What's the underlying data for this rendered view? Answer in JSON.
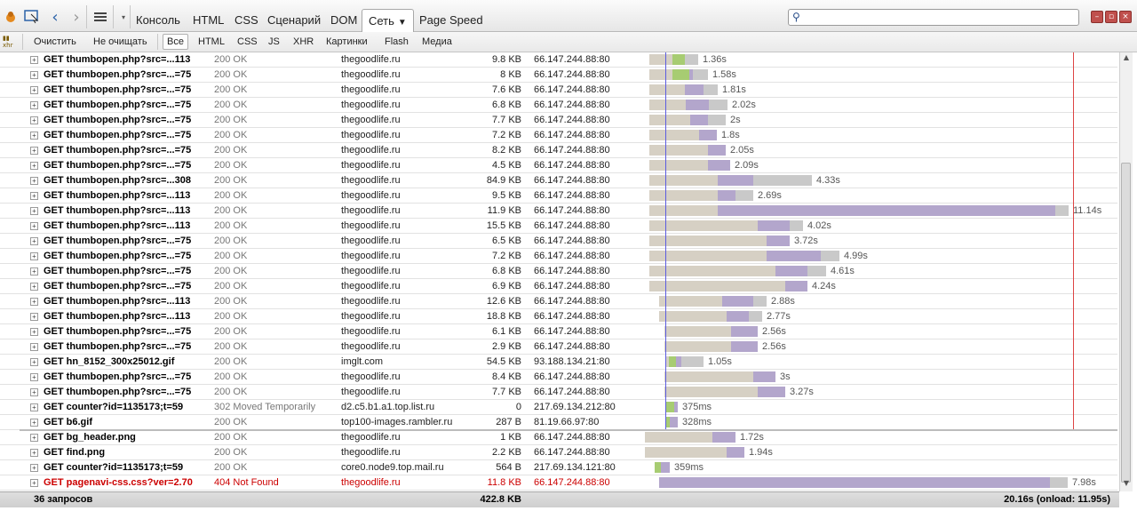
{
  "toolbar": {
    "tabs": [
      "Консоль",
      "HTML",
      "CSS",
      "Сценарий",
      "DOM",
      "Сеть",
      "Page Speed"
    ],
    "active_tab": "Сеть",
    "search": {
      "value": "",
      "placeholder": ""
    }
  },
  "filters": [
    "Очистить",
    "Не очищать",
    "Все",
    "HTML",
    "CSS",
    "JS",
    "XHR",
    "Картинки",
    "Flash",
    "Медиа"
  ],
  "selected_filter": "Все",
  "requests": [
    {
      "url": "GET thumbopen.php?src=...113",
      "status": "200 OK",
      "domain": "thegoodlife.ru",
      "size": "9.8 KB",
      "ip": "66.147.244.88:80",
      "time": "1.36s",
      "start": 731,
      "wait": 26,
      "conn": 14,
      "recv": 0,
      "post": 15
    },
    {
      "url": "GET thumbopen.php?src=...=75",
      "status": "200 OK",
      "domain": "thegoodlife.ru",
      "size": "8 KB",
      "ip": "66.147.244.88:80",
      "time": "1.58s",
      "start": 731,
      "wait": 26,
      "conn": 19,
      "recv": 4,
      "post": 17
    },
    {
      "url": "GET thumbopen.php?src=...=75",
      "status": "200 OK",
      "domain": "thegoodlife.ru",
      "size": "7.6 KB",
      "ip": "66.147.244.88:80",
      "time": "1.81s",
      "start": 731,
      "wait": 40,
      "conn": 0,
      "recv": 21,
      "post": 16
    },
    {
      "url": "GET thumbopen.php?src=...=75",
      "status": "200 OK",
      "domain": "thegoodlife.ru",
      "size": "6.8 KB",
      "ip": "66.147.244.88:80",
      "time": "2.02s",
      "start": 731,
      "wait": 41,
      "conn": 0,
      "recv": 26,
      "post": 21
    },
    {
      "url": "GET thumbopen.php?src=...=75",
      "status": "200 OK",
      "domain": "thegoodlife.ru",
      "size": "7.7 KB",
      "ip": "66.147.244.88:80",
      "time": "2s",
      "start": 731,
      "wait": 46,
      "conn": 0,
      "recv": 20,
      "post": 20
    },
    {
      "url": "GET thumbopen.php?src=...=75",
      "status": "200 OK",
      "domain": "thegoodlife.ru",
      "size": "7.2 KB",
      "ip": "66.147.244.88:80",
      "time": "1.8s",
      "start": 731,
      "wait": 56,
      "conn": 0,
      "recv": 20,
      "post": 0
    },
    {
      "url": "GET thumbopen.php?src=...=75",
      "status": "200 OK",
      "domain": "thegoodlife.ru",
      "size": "8.2 KB",
      "ip": "66.147.244.88:80",
      "time": "2.05s",
      "start": 731,
      "wait": 66,
      "conn": 0,
      "recv": 20,
      "post": 0
    },
    {
      "url": "GET thumbopen.php?src=...=75",
      "status": "200 OK",
      "domain": "thegoodlife.ru",
      "size": "4.5 KB",
      "ip": "66.147.244.88:80",
      "time": "2.09s",
      "start": 731,
      "wait": 66,
      "conn": 0,
      "recv": 25,
      "post": 0
    },
    {
      "url": "GET thumbopen.php?src=...308",
      "status": "200 OK",
      "domain": "thegoodlife.ru",
      "size": "84.9 KB",
      "ip": "66.147.244.88:80",
      "time": "4.33s",
      "start": 731,
      "wait": 77,
      "conn": 0,
      "recv": 40,
      "post": 66
    },
    {
      "url": "GET thumbopen.php?src=...113",
      "status": "200 OK",
      "domain": "thegoodlife.ru",
      "size": "9.5 KB",
      "ip": "66.147.244.88:80",
      "time": "2.69s",
      "start": 731,
      "wait": 77,
      "conn": 0,
      "recv": 20,
      "post": 20
    },
    {
      "url": "GET thumbopen.php?src=...113",
      "status": "200 OK",
      "domain": "thegoodlife.ru",
      "size": "11.9 KB",
      "ip": "66.147.244.88:80",
      "time": "11.14s",
      "start": 731,
      "wait": 77,
      "conn": 0,
      "recv": 380,
      "post": 15
    },
    {
      "url": "GET thumbopen.php?src=...113",
      "status": "200 OK",
      "domain": "thegoodlife.ru",
      "size": "15.5 KB",
      "ip": "66.147.244.88:80",
      "time": "4.02s",
      "start": 731,
      "wait": 122,
      "conn": 0,
      "recv": 36,
      "post": 15
    },
    {
      "url": "GET thumbopen.php?src=...=75",
      "status": "200 OK",
      "domain": "thegoodlife.ru",
      "size": "6.5 KB",
      "ip": "66.147.244.88:80",
      "time": "3.72s",
      "start": 731,
      "wait": 132,
      "conn": 0,
      "recv": 26,
      "post": 0
    },
    {
      "url": "GET thumbopen.php?src=...=75",
      "status": "200 OK",
      "domain": "thegoodlife.ru",
      "size": "7.2 KB",
      "ip": "66.147.244.88:80",
      "time": "4.99s",
      "start": 731,
      "wait": 132,
      "conn": 0,
      "recv": 61,
      "post": 21
    },
    {
      "url": "GET thumbopen.php?src=...=75",
      "status": "200 OK",
      "domain": "thegoodlife.ru",
      "size": "6.8 KB",
      "ip": "66.147.244.88:80",
      "time": "4.61s",
      "start": 731,
      "wait": 142,
      "conn": 0,
      "recv": 36,
      "post": 21
    },
    {
      "url": "GET thumbopen.php?src=...=75",
      "status": "200 OK",
      "domain": "thegoodlife.ru",
      "size": "6.9 KB",
      "ip": "66.147.244.88:80",
      "time": "4.24s",
      "start": 731,
      "wait": 153,
      "conn": 0,
      "recv": 25,
      "post": 0
    },
    {
      "url": "GET thumbopen.php?src=...113",
      "status": "200 OK",
      "domain": "thegoodlife.ru",
      "size": "12.6 KB",
      "ip": "66.147.244.88:80",
      "time": "2.88s",
      "start": 742,
      "wait": 71,
      "conn": 0,
      "recv": 35,
      "post": 15
    },
    {
      "url": "GET thumbopen.php?src=...113",
      "status": "200 OK",
      "domain": "thegoodlife.ru",
      "size": "18.8 KB",
      "ip": "66.147.244.88:80",
      "time": "2.77s",
      "start": 742,
      "wait": 76,
      "conn": 0,
      "recv": 25,
      "post": 15
    },
    {
      "url": "GET thumbopen.php?src=...=75",
      "status": "200 OK",
      "domain": "thegoodlife.ru",
      "size": "6.1 KB",
      "ip": "66.147.244.88:80",
      "time": "2.56s",
      "start": 748,
      "wait": 75,
      "conn": 0,
      "recv": 30,
      "post": 0
    },
    {
      "url": "GET thumbopen.php?src=...=75",
      "status": "200 OK",
      "domain": "thegoodlife.ru",
      "size": "2.9 KB",
      "ip": "66.147.244.88:80",
      "time": "2.56s",
      "start": 748,
      "wait": 75,
      "conn": 0,
      "recv": 30,
      "post": 0
    },
    {
      "url": "GET hn_8152_300x25012.gif",
      "status": "200 OK",
      "domain": "imglt.com",
      "size": "54.5 KB",
      "ip": "93.188.134.21:80",
      "time": "1.05s",
      "start": 749,
      "wait": 4,
      "conn": 8,
      "recv": 6,
      "post": 25
    },
    {
      "url": "GET thumbopen.php?src=...=75",
      "status": "200 OK",
      "domain": "thegoodlife.ru",
      "size": "8.4 KB",
      "ip": "66.147.244.88:80",
      "time": "3s",
      "start": 748,
      "wait": 100,
      "conn": 0,
      "recv": 25,
      "post": 0
    },
    {
      "url": "GET thumbopen.php?src=...=75",
      "status": "200 OK",
      "domain": "thegoodlife.ru",
      "size": "7.7 KB",
      "ip": "66.147.244.88:80",
      "time": "3.27s",
      "start": 748,
      "wait": 105,
      "conn": 0,
      "recv": 31,
      "post": 0
    },
    {
      "url": "GET counter?id=1135173;t=59",
      "status": "302 Moved Temporarily",
      "domain": "d2.c5.b1.a1.top.list.ru",
      "size": "0",
      "ip": "217.69.134.212:80",
      "time": "375ms",
      "start": 750,
      "wait": 0,
      "conn": 9,
      "recv": 4,
      "post": 0
    },
    {
      "url": "GET b6.gif",
      "status": "200 OK",
      "domain": "top100-images.rambler.ru",
      "size": "287 B",
      "ip": "81.19.66.97:80",
      "time": "328ms",
      "start": 750,
      "wait": 0,
      "conn": 4,
      "recv": 9,
      "post": 0
    },
    {
      "url": "GET bg_header.png",
      "status": "200 OK",
      "domain": "thegoodlife.ru",
      "size": "1 KB",
      "ip": "66.147.244.88:80",
      "time": "1.72s",
      "start": 726,
      "wait": 76,
      "conn": 0,
      "recv": 26,
      "post": 0,
      "group": true
    },
    {
      "url": "GET find.png",
      "status": "200 OK",
      "domain": "thegoodlife.ru",
      "size": "2.2 KB",
      "ip": "66.147.244.88:80",
      "time": "1.94s",
      "start": 726,
      "wait": 92,
      "conn": 0,
      "recv": 20,
      "post": 0
    },
    {
      "url": "GET counter?id=1135173;t=59",
      "status": "200 OK",
      "domain": "core0.node9.top.mail.ru",
      "size": "564 B",
      "ip": "217.69.134.121:80",
      "time": "359ms",
      "start": 737,
      "wait": 0,
      "conn": 7,
      "recv": 10,
      "post": 0
    },
    {
      "url": "GET pagenavi-css.css?ver=2.70",
      "status": "404 Not Found",
      "domain": "thegoodlife.ru",
      "size": "11.8 KB",
      "ip": "66.147.244.88:80",
      "time": "7.98s",
      "start": 742,
      "wait": 0,
      "conn": 0,
      "recv": 440,
      "post": 20,
      "error": true
    }
  ],
  "summary": {
    "count": "36 запросов",
    "total_size": "422.8 KB",
    "timing": "20.16s (onload: 11.95s)"
  },
  "colors": {
    "waiting": "#d6d0c4",
    "connecting": "#a7cc72",
    "receiving": "#b3a6cc",
    "after": "#c9c9c9",
    "dom_line": "#5c5ce0",
    "load_line": "#dd4444",
    "error": "#cc0000"
  }
}
